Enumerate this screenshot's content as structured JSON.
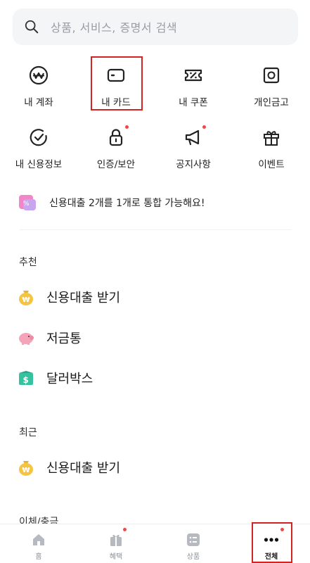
{
  "search": {
    "placeholder": "상품, 서비스, 증명서 검색"
  },
  "menu": [
    {
      "label": "내 계좌",
      "icon": "won-circle-icon",
      "badge": false
    },
    {
      "label": "내 카드",
      "icon": "card-icon",
      "badge": false
    },
    {
      "label": "내 쿠폰",
      "icon": "coupon-icon",
      "badge": false
    },
    {
      "label": "개인금고",
      "icon": "safe-icon",
      "badge": false
    },
    {
      "label": "내 신용정보",
      "icon": "credit-check-icon",
      "badge": false
    },
    {
      "label": "인증/보안",
      "icon": "lock-icon",
      "badge": true
    },
    {
      "label": "공지사항",
      "icon": "megaphone-icon",
      "badge": true
    },
    {
      "label": "이벤트",
      "icon": "gift-icon",
      "badge": false
    }
  ],
  "banner": {
    "text": "신용대출 2개를 1개로 통합 가능해요!",
    "icon": "loan-merge-icon"
  },
  "recommend": {
    "title": "추천",
    "items": [
      {
        "label": "신용대출 받기",
        "icon": "money-bag-icon"
      },
      {
        "label": "저금통",
        "icon": "piggy-bank-icon"
      },
      {
        "label": "달러박스",
        "icon": "dollar-box-icon"
      }
    ]
  },
  "recent": {
    "title": "최근",
    "items": [
      {
        "label": "신용대출 받기",
        "icon": "money-bag-icon"
      }
    ]
  },
  "next_section": {
    "title": "이체/충금"
  },
  "tabs": [
    {
      "label": "홈",
      "icon": "home-icon",
      "badge": false,
      "active": false
    },
    {
      "label": "혜택",
      "icon": "gift-tab-icon",
      "badge": true,
      "active": false
    },
    {
      "label": "상품",
      "icon": "list-icon",
      "badge": false,
      "active": false
    },
    {
      "label": "전체",
      "icon": "more-icon",
      "badge": true,
      "active": true
    }
  ],
  "colors": {
    "accent_red": "#ef4a4a",
    "highlight_border": "#d32424",
    "tab_icon": "#b6b9bf",
    "text": "#222222"
  }
}
